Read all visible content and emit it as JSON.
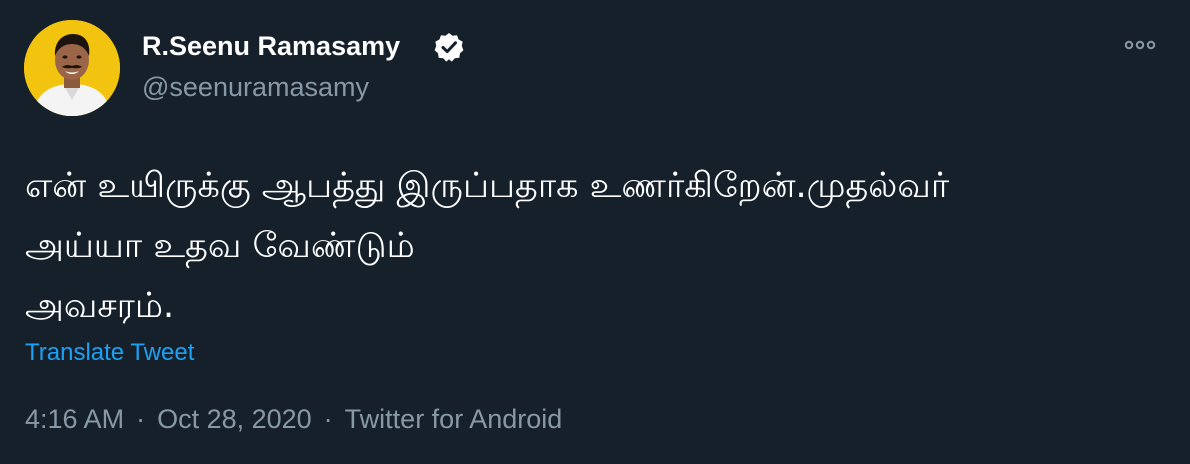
{
  "tweet": {
    "author": {
      "display_name": "R.Seenu Ramasamy",
      "handle": "@seenuramasamy",
      "verified": true
    },
    "text": "என் உயிருக்கு ஆபத்து இருப்பதாக உணர்கிறேன்.முதல்வர்\nஅய்யா உதவ வேண்டும்\nஅவசரம்.",
    "translate_label": "Translate Tweet",
    "time": "4:16 AM",
    "separator": "·",
    "date": "Oct 28, 2020",
    "source": "Twitter for Android"
  },
  "icons": {
    "verified": "verified-badge-icon",
    "more": "more-options-icon"
  },
  "colors": {
    "background": "#15202b",
    "primary_text": "#ffffff",
    "secondary_text": "#8899a6",
    "link": "#1da1f2",
    "avatar_background": "#f2c40f"
  }
}
